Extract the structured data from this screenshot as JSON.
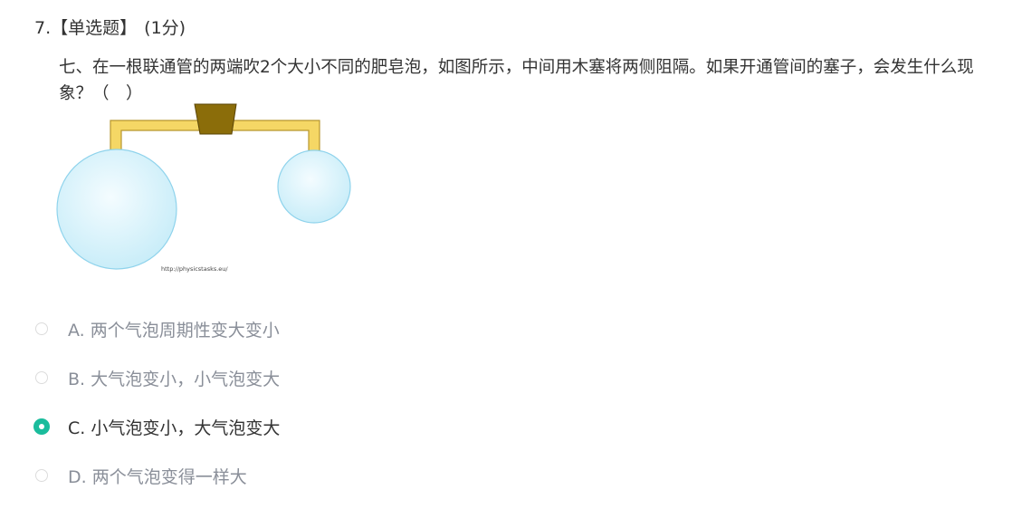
{
  "question": {
    "number": "7.",
    "type_label": "【单选题】",
    "score": "(1分)",
    "text": "七、在一根联通管的两端吹2个大小不同的肥皂泡，如图所示，中间用木塞将两侧阻隔。如果开通管间的塞子，会发生什么现象？（　）"
  },
  "figure": {
    "watermark": "http://physicstasks.eu/",
    "colors": {
      "tube_fill": "#f5d765",
      "tube_stroke": "#b8962e",
      "cork_fill": "#8b6d0a",
      "bubble_fill": "#d6f2fb",
      "bubble_stroke": "#8fd3ec"
    }
  },
  "options": [
    {
      "letter": "A.",
      "text": "两个气泡周期性变大变小",
      "selected": false
    },
    {
      "letter": "B.",
      "text": "大气泡变小，小气泡变大",
      "selected": false
    },
    {
      "letter": "C.",
      "text": "小气泡变小，大气泡变大",
      "selected": true
    },
    {
      "letter": "D.",
      "text": "两个气泡变得一样大",
      "selected": false
    }
  ],
  "colors": {
    "accent": "#1abc9c",
    "text_primary": "#333333",
    "text_muted": "#8a8f99"
  }
}
